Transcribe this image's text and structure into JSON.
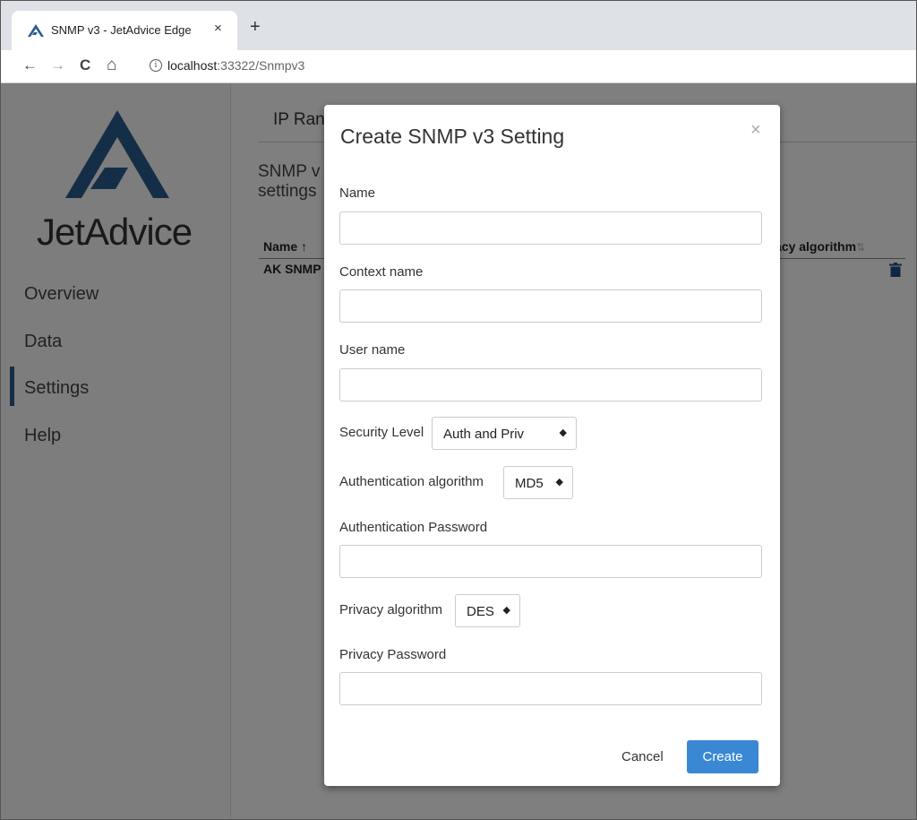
{
  "browser": {
    "tab_title": "SNMP v3 - JetAdvice Edge",
    "tab_close": "×",
    "new_tab": "+",
    "back": "←",
    "forward": "→",
    "reload": "C",
    "home": "⌂",
    "info": "i",
    "url_host": "localhost",
    "url_path": ":33322/Snmpv3"
  },
  "sidebar": {
    "brand": "JetAdvice",
    "items": [
      {
        "label": "Overview"
      },
      {
        "label": "Data"
      },
      {
        "label": "Settings"
      },
      {
        "label": "Help"
      }
    ]
  },
  "main": {
    "tab_label": "IP Ran",
    "heading": "SNMP v settings",
    "columns": {
      "name": "Name ↑",
      "privacy": "acy algorithm"
    },
    "sort_icon": "⇅",
    "rows": [
      {
        "name": "AK SNMP"
      }
    ]
  },
  "modal": {
    "title": "Create SNMP v3 Setting",
    "close": "×",
    "name_label": "Name",
    "name_value": "",
    "context_label": "Context name",
    "context_value": "",
    "user_label": "User name",
    "user_value": "",
    "security_label": "Security Level",
    "security_value": "Auth and Priv",
    "auth_alg_label": "Authentication algorithm",
    "auth_alg_value": "MD5",
    "auth_pwd_label": "Authentication Password",
    "auth_pwd_value": "",
    "priv_alg_label": "Privacy algorithm",
    "priv_alg_value": "DES",
    "priv_pwd_label": "Privacy Password",
    "priv_pwd_value": "",
    "select_arrow": "◆",
    "cancel": "Cancel",
    "create": "Create"
  },
  "colors": {
    "brand_blue": "#2a5c8f",
    "primary_button": "#3a87d4"
  }
}
